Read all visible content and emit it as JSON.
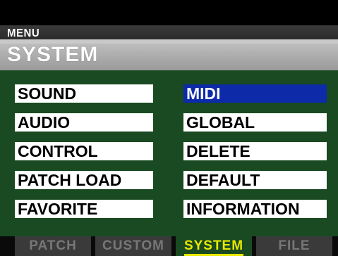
{
  "header": {
    "menu_label": "MENU",
    "title": "SYSTEM"
  },
  "menu": {
    "left": [
      "SOUND",
      "AUDIO",
      "CONTROL",
      "PATCH LOAD",
      "FAVORITE"
    ],
    "right": [
      "MIDI",
      "GLOBAL",
      "DELETE",
      "DEFAULT",
      "INFORMATION"
    ],
    "selected": "MIDI"
  },
  "tabs": [
    {
      "label": "PATCH",
      "active": false
    },
    {
      "label": "CUSTOM",
      "active": false
    },
    {
      "label": "SYSTEM",
      "active": true
    },
    {
      "label": "FILE",
      "active": false
    }
  ],
  "colors": {
    "panel_green": "#1a4a21",
    "selection_blue": "#0d2aa8",
    "active_tab_text": "#e8e800"
  }
}
